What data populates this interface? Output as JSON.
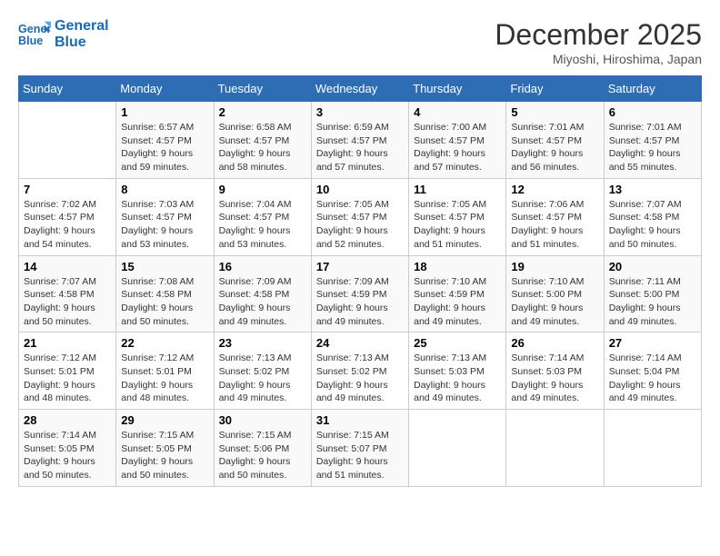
{
  "header": {
    "logo_line1": "General",
    "logo_line2": "Blue",
    "month": "December 2025",
    "location": "Miyoshi, Hiroshima, Japan"
  },
  "days_of_week": [
    "Sunday",
    "Monday",
    "Tuesday",
    "Wednesday",
    "Thursday",
    "Friday",
    "Saturday"
  ],
  "weeks": [
    [
      {
        "day": "",
        "info": ""
      },
      {
        "day": "1",
        "info": "Sunrise: 6:57 AM\nSunset: 4:57 PM\nDaylight: 9 hours\nand 59 minutes."
      },
      {
        "day": "2",
        "info": "Sunrise: 6:58 AM\nSunset: 4:57 PM\nDaylight: 9 hours\nand 58 minutes."
      },
      {
        "day": "3",
        "info": "Sunrise: 6:59 AM\nSunset: 4:57 PM\nDaylight: 9 hours\nand 57 minutes."
      },
      {
        "day": "4",
        "info": "Sunrise: 7:00 AM\nSunset: 4:57 PM\nDaylight: 9 hours\nand 57 minutes."
      },
      {
        "day": "5",
        "info": "Sunrise: 7:01 AM\nSunset: 4:57 PM\nDaylight: 9 hours\nand 56 minutes."
      },
      {
        "day": "6",
        "info": "Sunrise: 7:01 AM\nSunset: 4:57 PM\nDaylight: 9 hours\nand 55 minutes."
      }
    ],
    [
      {
        "day": "7",
        "info": "Sunrise: 7:02 AM\nSunset: 4:57 PM\nDaylight: 9 hours\nand 54 minutes."
      },
      {
        "day": "8",
        "info": "Sunrise: 7:03 AM\nSunset: 4:57 PM\nDaylight: 9 hours\nand 53 minutes."
      },
      {
        "day": "9",
        "info": "Sunrise: 7:04 AM\nSunset: 4:57 PM\nDaylight: 9 hours\nand 53 minutes."
      },
      {
        "day": "10",
        "info": "Sunrise: 7:05 AM\nSunset: 4:57 PM\nDaylight: 9 hours\nand 52 minutes."
      },
      {
        "day": "11",
        "info": "Sunrise: 7:05 AM\nSunset: 4:57 PM\nDaylight: 9 hours\nand 51 minutes."
      },
      {
        "day": "12",
        "info": "Sunrise: 7:06 AM\nSunset: 4:57 PM\nDaylight: 9 hours\nand 51 minutes."
      },
      {
        "day": "13",
        "info": "Sunrise: 7:07 AM\nSunset: 4:58 PM\nDaylight: 9 hours\nand 50 minutes."
      }
    ],
    [
      {
        "day": "14",
        "info": "Sunrise: 7:07 AM\nSunset: 4:58 PM\nDaylight: 9 hours\nand 50 minutes."
      },
      {
        "day": "15",
        "info": "Sunrise: 7:08 AM\nSunset: 4:58 PM\nDaylight: 9 hours\nand 50 minutes."
      },
      {
        "day": "16",
        "info": "Sunrise: 7:09 AM\nSunset: 4:58 PM\nDaylight: 9 hours\nand 49 minutes."
      },
      {
        "day": "17",
        "info": "Sunrise: 7:09 AM\nSunset: 4:59 PM\nDaylight: 9 hours\nand 49 minutes."
      },
      {
        "day": "18",
        "info": "Sunrise: 7:10 AM\nSunset: 4:59 PM\nDaylight: 9 hours\nand 49 minutes."
      },
      {
        "day": "19",
        "info": "Sunrise: 7:10 AM\nSunset: 5:00 PM\nDaylight: 9 hours\nand 49 minutes."
      },
      {
        "day": "20",
        "info": "Sunrise: 7:11 AM\nSunset: 5:00 PM\nDaylight: 9 hours\nand 49 minutes."
      }
    ],
    [
      {
        "day": "21",
        "info": "Sunrise: 7:12 AM\nSunset: 5:01 PM\nDaylight: 9 hours\nand 48 minutes."
      },
      {
        "day": "22",
        "info": "Sunrise: 7:12 AM\nSunset: 5:01 PM\nDaylight: 9 hours\nand 48 minutes."
      },
      {
        "day": "23",
        "info": "Sunrise: 7:13 AM\nSunset: 5:02 PM\nDaylight: 9 hours\nand 49 minutes."
      },
      {
        "day": "24",
        "info": "Sunrise: 7:13 AM\nSunset: 5:02 PM\nDaylight: 9 hours\nand 49 minutes."
      },
      {
        "day": "25",
        "info": "Sunrise: 7:13 AM\nSunset: 5:03 PM\nDaylight: 9 hours\nand 49 minutes."
      },
      {
        "day": "26",
        "info": "Sunrise: 7:14 AM\nSunset: 5:03 PM\nDaylight: 9 hours\nand 49 minutes."
      },
      {
        "day": "27",
        "info": "Sunrise: 7:14 AM\nSunset: 5:04 PM\nDaylight: 9 hours\nand 49 minutes."
      }
    ],
    [
      {
        "day": "28",
        "info": "Sunrise: 7:14 AM\nSunset: 5:05 PM\nDaylight: 9 hours\nand 50 minutes."
      },
      {
        "day": "29",
        "info": "Sunrise: 7:15 AM\nSunset: 5:05 PM\nDaylight: 9 hours\nand 50 minutes."
      },
      {
        "day": "30",
        "info": "Sunrise: 7:15 AM\nSunset: 5:06 PM\nDaylight: 9 hours\nand 50 minutes."
      },
      {
        "day": "31",
        "info": "Sunrise: 7:15 AM\nSunset: 5:07 PM\nDaylight: 9 hours\nand 51 minutes."
      },
      {
        "day": "",
        "info": ""
      },
      {
        "day": "",
        "info": ""
      },
      {
        "day": "",
        "info": ""
      }
    ]
  ]
}
